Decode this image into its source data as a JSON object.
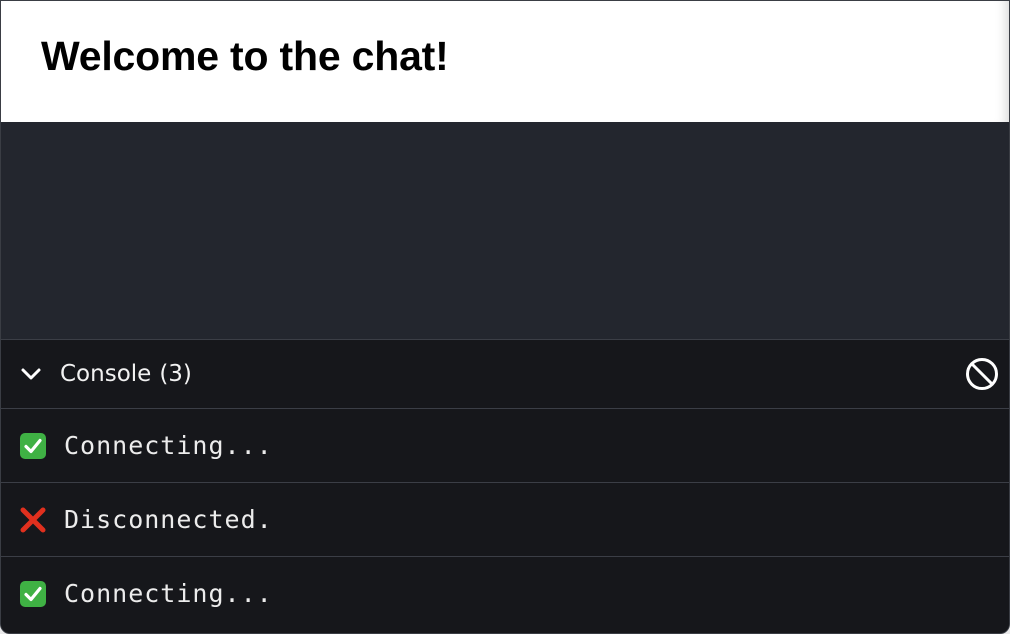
{
  "preview": {
    "heading": "Welcome to the chat!"
  },
  "console": {
    "title": "Console",
    "count_label": "(3)",
    "clear_icon": "clear-console-icon",
    "collapse_icon": "chevron-down-icon",
    "entries": [
      {
        "status": "success",
        "icon": "check-icon",
        "text": "Connecting..."
      },
      {
        "status": "error",
        "icon": "cross-icon",
        "text": "Disconnected."
      },
      {
        "status": "success",
        "icon": "check-icon",
        "text": "Connecting..."
      }
    ]
  },
  "colors": {
    "success": "#3fb144",
    "error": "#e0301e",
    "console_bg": "#16171b",
    "panel_bg": "#23262e"
  }
}
